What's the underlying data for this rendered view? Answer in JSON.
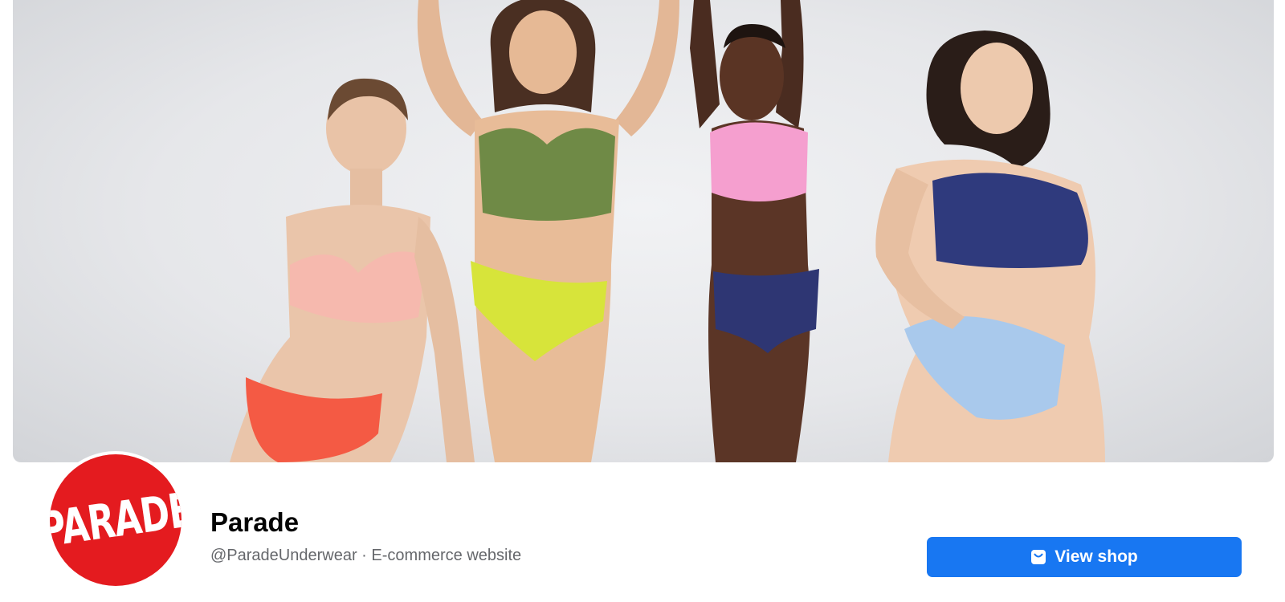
{
  "cover": {
    "alt": "",
    "colors": {
      "background": "#e6e7ea",
      "peach_bra": "#f6b9ae",
      "coral_brief": "#f45a44",
      "olive_bra": "#6f8a46",
      "lime_brief": "#d7e43a",
      "pink_bra": "#f59fcf",
      "navy_brief": "#2e3673",
      "navy_bra": "#2f3a7d",
      "light_blue_brief": "#a9c9ec"
    }
  },
  "logo": {
    "text": "PARADE",
    "color": "#e41b1f"
  },
  "page": {
    "name": "Parade",
    "handle": "@ParadeUnderwear",
    "separator": " · ",
    "category": "E-commerce website"
  },
  "actions": {
    "view_shop_label": "View shop",
    "view_shop_icon": "shop-bag-icon",
    "accent": "#1877f2"
  }
}
